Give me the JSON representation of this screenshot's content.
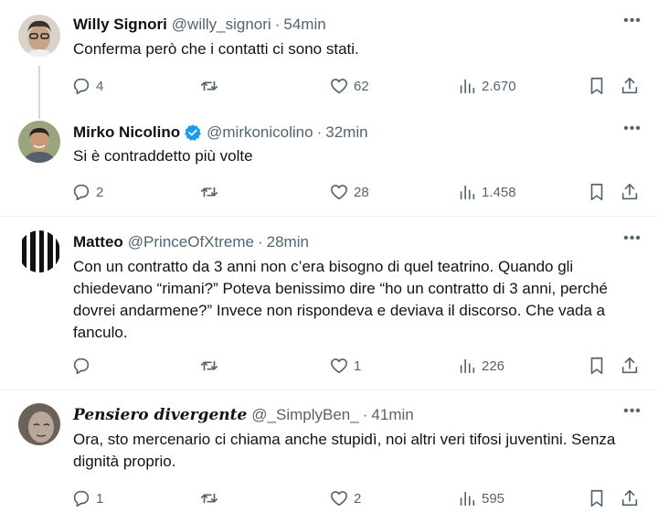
{
  "tweets": [
    {
      "name": "Willy Signori",
      "handle": "@willy_signori",
      "time": "54min",
      "text": "Conferma però che i contatti ci sono stati.",
      "replies": "4",
      "retweets": "",
      "likes": "62",
      "views": "2.670",
      "avatar_colors": {
        "bg": "#d8d2c8",
        "face": "#c9a387",
        "hair": "#3b3128"
      }
    },
    {
      "name": "Mirko Nicolino",
      "handle": "@mirkonicolino",
      "time": "32min",
      "verified": true,
      "text": "Si è contraddetto più volte",
      "replies": "2",
      "retweets": "",
      "likes": "28",
      "views": "1.458",
      "avatar_colors": {
        "bg": "#9aa57e",
        "face": "#c99976",
        "hair": "#2a2420"
      }
    },
    {
      "name": "Matteo",
      "handle": "@PrinceOfXtreme",
      "time": "28min",
      "text": "Con un contratto da 3 anni non c’era bisogno di quel teatrino. Quando gli chiedevano “rimani?” Poteva benissimo dire “ho un contratto di 3 anni, perché dovrei andarmene?” Invece non rispondeva e deviava il discorso. Che vada a fanculo.",
      "replies": "",
      "retweets": "",
      "likes": "1",
      "views": "226",
      "avatar_colors": {
        "bg": "#ffffff",
        "stripes": "#111111"
      }
    },
    {
      "name": "Pensiero divergente",
      "handle": "@_SimplyBen_",
      "time": "41min",
      "text": "Ora, sto mercenario ci chiama anche stupidì, noi altri veri tifosi juventini. Senza dignità proprio.",
      "replies": "1",
      "retweets": "",
      "likes": "2",
      "views": "595",
      "avatar_colors": {
        "bg": "#6a6258",
        "face": "#b9a89a"
      }
    }
  ],
  "colors": {
    "text": "#0f1419",
    "muted": "#536471",
    "verified": "#1d9bf0",
    "separator": "#eff3f4"
  },
  "icons": [
    "reply-icon",
    "retweet-icon",
    "like-icon",
    "views-icon",
    "bookmark-icon",
    "share-icon",
    "more-icon",
    "verified-badge-icon"
  ]
}
